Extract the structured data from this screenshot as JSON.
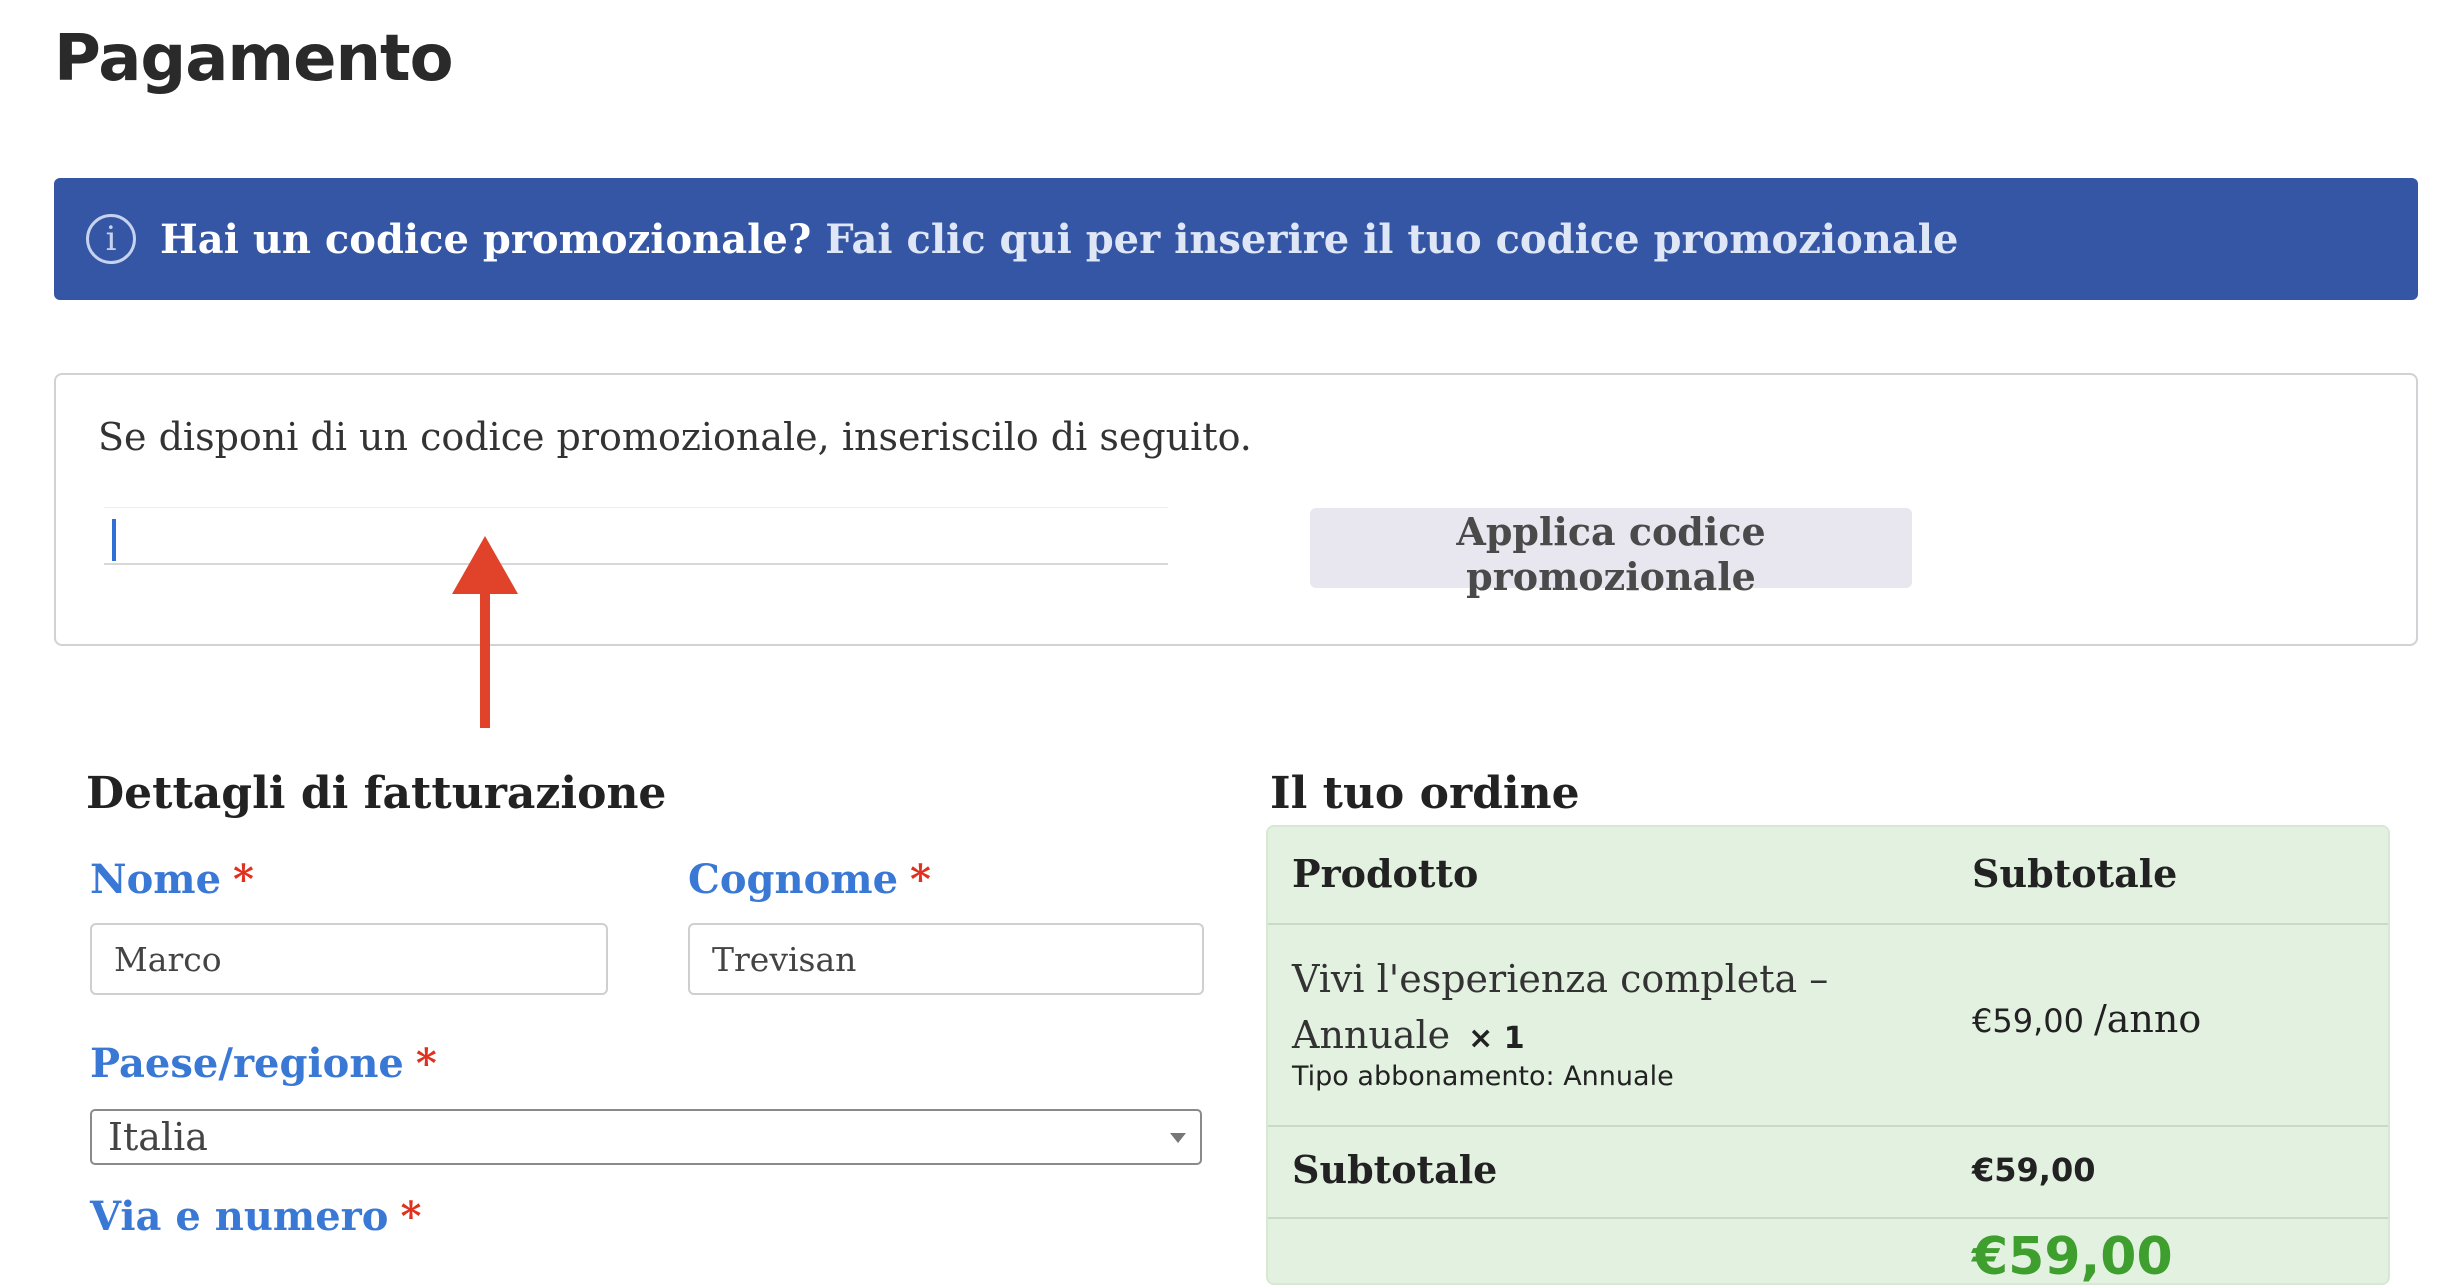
{
  "page": {
    "title": "Pagamento"
  },
  "notice": {
    "icon": "info-icon",
    "question": "Hai un codice promozionale?",
    "link": "Fai clic qui per inserire il tuo codice promozionale"
  },
  "promo": {
    "description": "Se disponi di un codice promozionale, inseriscilo di seguito.",
    "input_value": "",
    "apply_label": "Applica codice promozionale"
  },
  "billing": {
    "heading": "Dettagli di fatturazione",
    "required_marker": "*",
    "first_name": {
      "label": "Nome",
      "value": "Marco"
    },
    "last_name": {
      "label": "Cognome",
      "value": "Trevisan"
    },
    "country": {
      "label": "Paese/regione",
      "value": "Italia"
    },
    "street": {
      "label": "Via e numero"
    }
  },
  "order": {
    "heading": "Il tuo ordine",
    "col_product": "Prodotto",
    "col_subtotal": "Subtotale",
    "item": {
      "name": "Vivi l'esperienza completa – Annuale",
      "qty": "× 1",
      "meta": "Tipo abbonamento: Annuale",
      "price": "€59,00",
      "price_suffix": "/anno"
    },
    "subtotal_label": "Subtotale",
    "subtotal_value": "€59,00",
    "total_value": "€59,00"
  },
  "colors": {
    "notice_bg": "#3556a4",
    "label_blue": "#3a78d6",
    "required_red": "#e0301e",
    "order_bg": "#e3f1e1",
    "total_green": "#3e9e2e",
    "annotation_arrow": "#e0432a"
  }
}
